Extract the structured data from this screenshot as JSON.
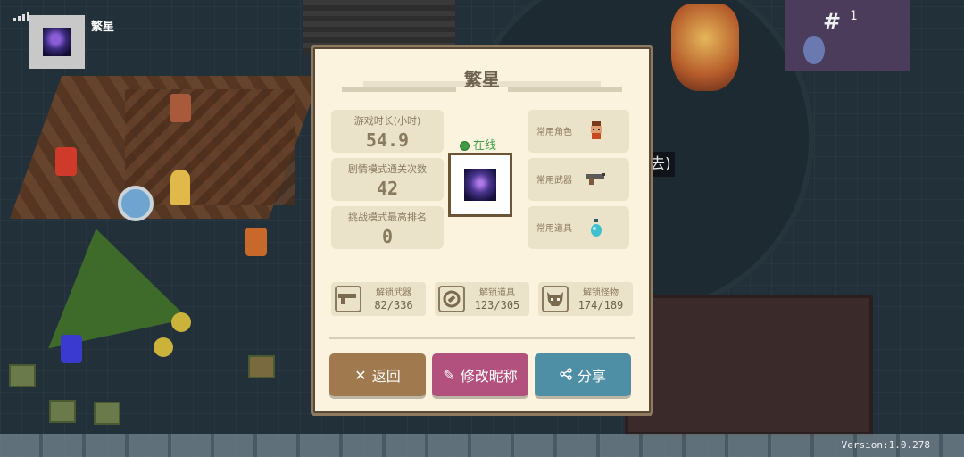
{
  "player": {
    "name": "繁星"
  },
  "hud": {
    "top_right_count": "1",
    "version": "Version:1.0.278",
    "bg_fragment": "去)"
  },
  "dialog": {
    "title": "繁星",
    "status": "在线",
    "stats": [
      {
        "label": "游戏时长(小时)",
        "value": "54.9"
      },
      {
        "label": "剧情模式通关次数",
        "value": "42"
      },
      {
        "label": "挑战模式最高排名",
        "value": "0"
      }
    ],
    "favorites": [
      {
        "label": "常用角色",
        "icon": "character-icon"
      },
      {
        "label": "常用武器",
        "icon": "pistol-icon"
      },
      {
        "label": "常用道具",
        "icon": "potion-icon"
      }
    ],
    "unlocks": [
      {
        "label": "解锁武器",
        "value": "82/336",
        "icon": "pistol-icon"
      },
      {
        "label": "解锁道具",
        "value": "123/305",
        "icon": "item-icon"
      },
      {
        "label": "解锁怪物",
        "value": "174/189",
        "icon": "monster-icon"
      }
    ],
    "buttons": {
      "back": "返回",
      "rename": "修改昵称",
      "share": "分享"
    }
  },
  "colors": {
    "back_button": "#a07a4e",
    "rename_button": "#b2507e",
    "share_button": "#4f8fa6",
    "online_green": "#3e9a44",
    "panel_bg": "#fbf3de"
  }
}
